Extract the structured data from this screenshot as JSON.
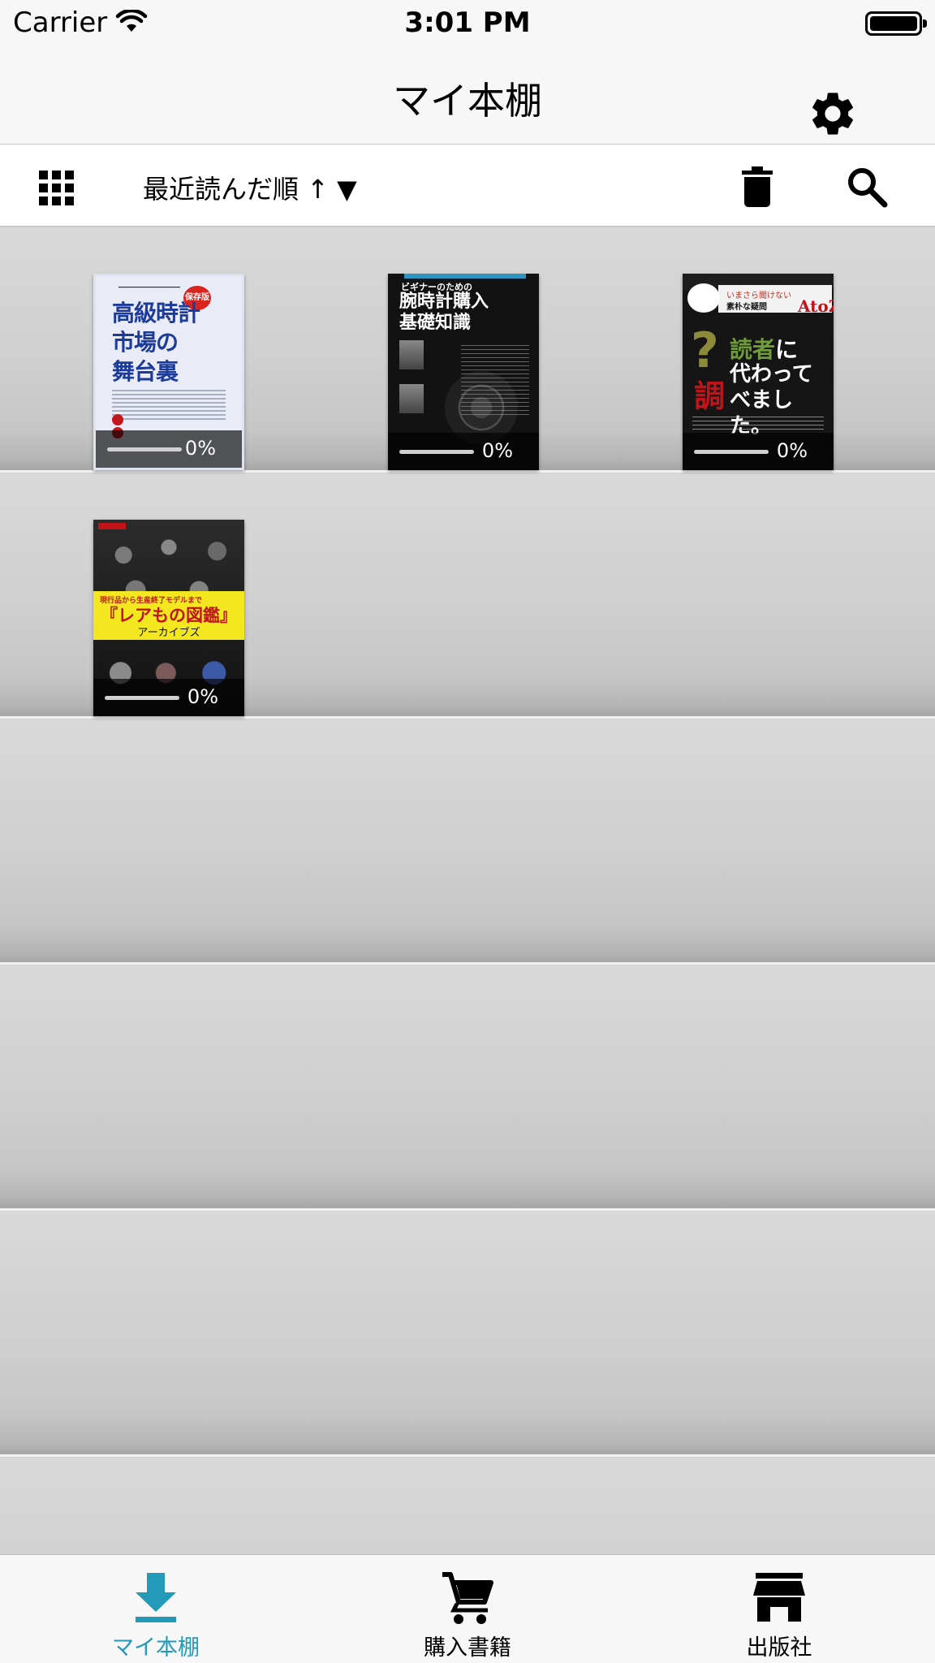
{
  "status_bar": {
    "carrier": "Carrier",
    "time": "3:01 PM"
  },
  "nav": {
    "title": "マイ本棚"
  },
  "toolbar": {
    "sort_label": "最近読んだ順 ↑ ▼"
  },
  "books": [
    {
      "progress_text": "0%",
      "progress": 0,
      "cover_title_lines": [
        "高級時計",
        "市場の",
        "舞台裏"
      ],
      "cover_badge": "保存版"
    },
    {
      "progress_text": "0%",
      "progress": 0,
      "cover_small": "ビギナーのための",
      "cover_title_lines": [
        "腕時計購入",
        "基礎知識"
      ]
    },
    {
      "progress_text": "0%",
      "progress": 0,
      "cover_sub1": "いまさら聞けない",
      "cover_sub2": "素朴な疑問",
      "cover_az": "AtoZ",
      "cover_main1a": "読者",
      "cover_main1b": "に",
      "cover_main2_lines": [
        "代わって",
        "べました。"
      ],
      "cover_red": "調"
    },
    {
      "progress_text": "0%",
      "progress": 0,
      "cover_small": "現行品から生産終了モデルまで",
      "cover_title": "『レアもの図鑑』",
      "cover_sub": "アーカイブズ"
    }
  ],
  "tabs": [
    {
      "label": "マイ本棚",
      "icon": "download-icon",
      "active": true
    },
    {
      "label": "購入書籍",
      "icon": "cart-icon",
      "active": false
    },
    {
      "label": "出版社",
      "icon": "store-icon",
      "active": false
    }
  ],
  "colors": {
    "accent": "#229ab8",
    "shelf": "#d2d2d2",
    "bar_bg": "#f7f7f7"
  }
}
